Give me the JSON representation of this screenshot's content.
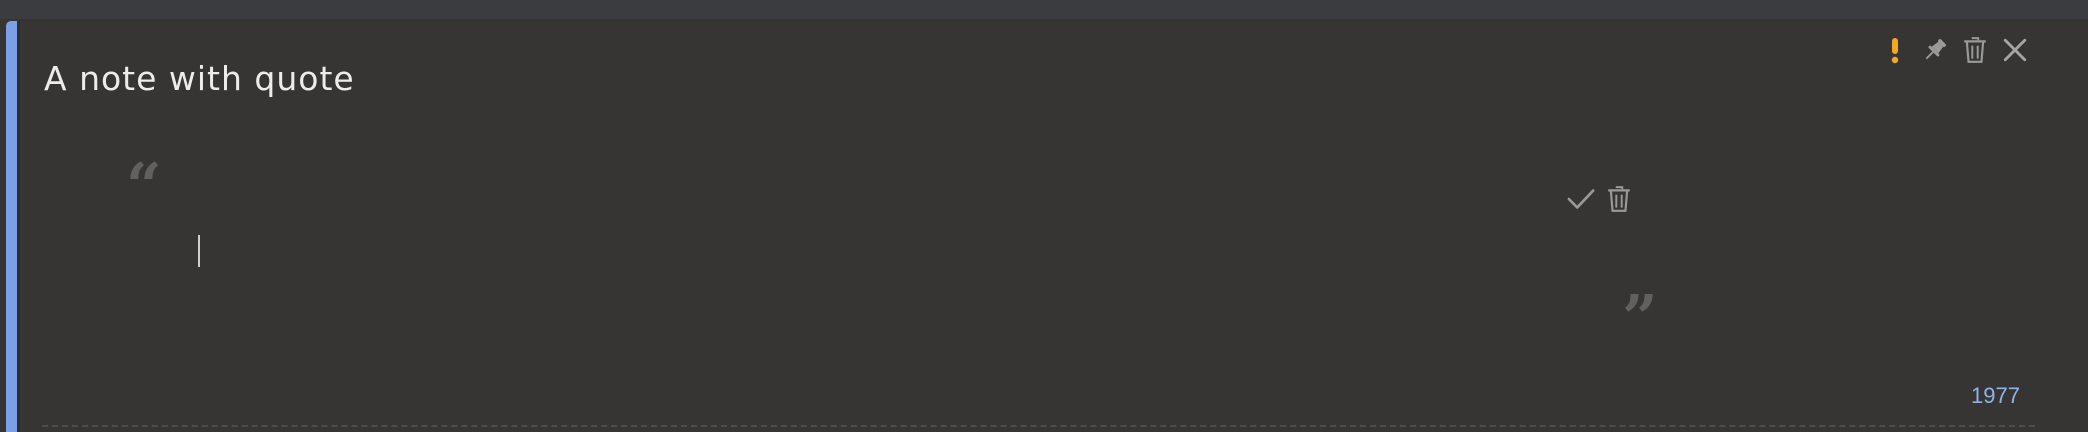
{
  "note": {
    "title": "A note with quote",
    "char_count": "1977",
    "accent_color": "#7d9fe6"
  },
  "toolbar": {
    "icons": [
      "priority-exclamation-icon",
      "pin-icon",
      "trash-icon",
      "close-icon"
    ],
    "priority_color": "#f5a623"
  },
  "quote": {
    "open_mark": "“",
    "close_mark": "”",
    "text": "",
    "actions": [
      "checkmark-icon",
      "trash-icon"
    ]
  }
}
